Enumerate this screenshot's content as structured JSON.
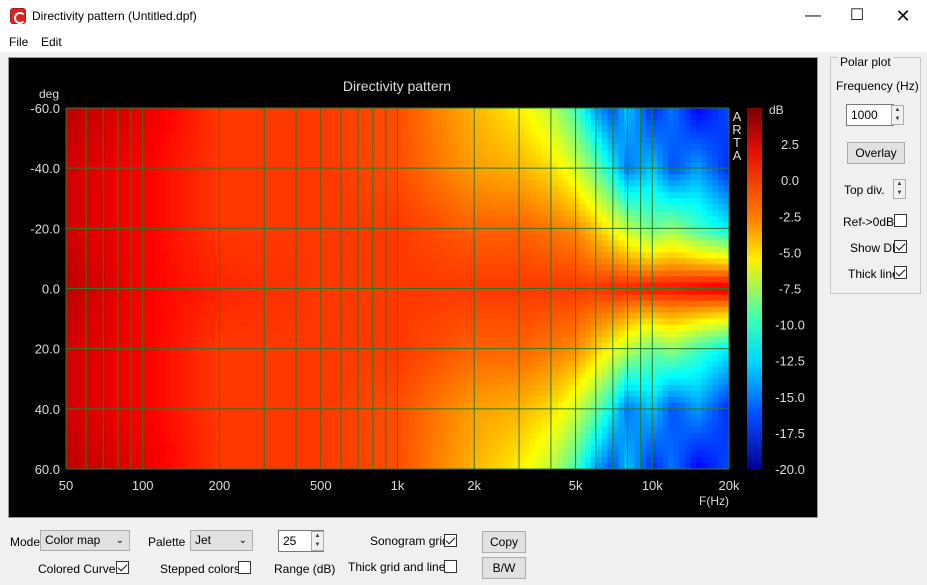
{
  "window": {
    "title": "Directivity pattern (Untitled.dpf)"
  },
  "menu": {
    "file": "File",
    "edit": "Edit"
  },
  "chart_data": {
    "type": "heatmap",
    "title": "Directivity pattern",
    "xlabel": "F(Hz)",
    "ylabel": "deg",
    "colorbar_label": "dB",
    "watermark": "ARTA",
    "x_scale": "log",
    "xlim": [
      50,
      20000
    ],
    "ylim": [
      -60,
      60
    ],
    "x_ticks": [
      50,
      100,
      200,
      500,
      1000,
      2000,
      5000,
      10000,
      20000
    ],
    "x_tick_labels": [
      "50",
      "100",
      "200",
      "500",
      "1k",
      "2k",
      "5k",
      "10k",
      "20k"
    ],
    "y_ticks": [
      -60,
      -40,
      -20,
      0,
      20,
      40,
      60
    ],
    "y_tick_labels": [
      "-60.0",
      "-40.0",
      "-20.0",
      "0.0",
      "20.0",
      "40.0",
      "60.0"
    ],
    "colorbar_range": [
      -20,
      5
    ],
    "colorbar_ticks": [
      "2.5",
      "0.0",
      "-2.5",
      "-5.0",
      "-7.5",
      "-10.0",
      "-12.5",
      "-15.0",
      "-17.5",
      "-20.0"
    ],
    "colorbar_tick_values": [
      2.5,
      0,
      -2.5,
      -5,
      -7.5,
      -10,
      -12.5,
      -15,
      -17.5,
      -20
    ],
    "palette": "Jet",
    "frequencies_hz": [
      50,
      100,
      200,
      500,
      1000,
      2000,
      3000,
      4000,
      5000,
      6000,
      7000,
      8000,
      10000,
      12000,
      15000,
      20000
    ],
    "angles_deg": [
      -60,
      -40,
      -20,
      0,
      20,
      40,
      60
    ],
    "values_db": [
      [
        3.5,
        2.5,
        0.5,
        0.5,
        0.0,
        -2.5,
        -4.0,
        -6.0,
        -9.0,
        -13.0,
        -15.0,
        -12.0,
        -16.0,
        -14.0,
        -17.0,
        -15.0
      ],
      [
        3.0,
        2.0,
        0.5,
        0.5,
        0.0,
        -2.0,
        -2.5,
        -3.5,
        -5.5,
        -8.0,
        -11.0,
        -14.0,
        -12.0,
        -15.0,
        -13.0,
        -16.0
      ],
      [
        3.0,
        2.0,
        0.5,
        0.5,
        0.5,
        -0.5,
        -0.5,
        -1.0,
        -1.5,
        -3.0,
        -4.5,
        -6.0,
        -8.0,
        -7.0,
        -9.0,
        -11.0
      ],
      [
        3.5,
        2.0,
        1.0,
        0.5,
        0.5,
        0.5,
        0.5,
        0.5,
        0.5,
        0.5,
        1.0,
        1.0,
        1.5,
        1.5,
        2.0,
        2.5
      ],
      [
        3.0,
        2.0,
        0.5,
        0.5,
        0.5,
        -0.5,
        -0.5,
        -1.0,
        -1.5,
        -3.0,
        -4.5,
        -6.0,
        -8.0,
        -7.0,
        -9.0,
        -11.0
      ],
      [
        3.0,
        2.0,
        0.5,
        0.5,
        0.0,
        -2.0,
        -2.5,
        -3.5,
        -5.5,
        -8.0,
        -11.0,
        -14.0,
        -12.0,
        -15.0,
        -13.0,
        -16.0
      ],
      [
        3.5,
        2.5,
        0.5,
        0.5,
        0.0,
        -2.5,
        -4.0,
        -6.0,
        -9.0,
        -13.0,
        -15.0,
        -12.0,
        -16.0,
        -14.0,
        -17.0,
        -15.0
      ]
    ]
  },
  "polar_plot": {
    "group_title": "Polar plot",
    "frequency_label": "Frequency (Hz)",
    "frequency_value": "1000",
    "overlay_button": "Overlay",
    "top_div_label": "Top div.",
    "ref_label": "Ref->0dB",
    "ref_checked": false,
    "show_di_label": "Show DI",
    "show_di_checked": true,
    "thick_line_label": "Thick line",
    "thick_line_checked": true
  },
  "controls": {
    "mode_label": "Mode",
    "mode_value": "Color map",
    "palette_label": "Palette",
    "palette_value": "Jet",
    "range_value": "25",
    "range_label": "Range (dB)",
    "sonogram_grid_label": "Sonogram grid",
    "sonogram_grid_checked": true,
    "copy_button": "Copy",
    "colored_curves_label": "Colored Curves",
    "colored_curves_checked": true,
    "stepped_colors_label": "Stepped colors",
    "stepped_colors_checked": false,
    "thick_grid_label": "Thick grid and  lines",
    "thick_grid_checked": false,
    "bw_button": "B/W"
  },
  "icons": {
    "app": "arta-app-icon",
    "minimize": "minimize-icon",
    "maximize": "maximize-icon",
    "close": "close-icon"
  }
}
